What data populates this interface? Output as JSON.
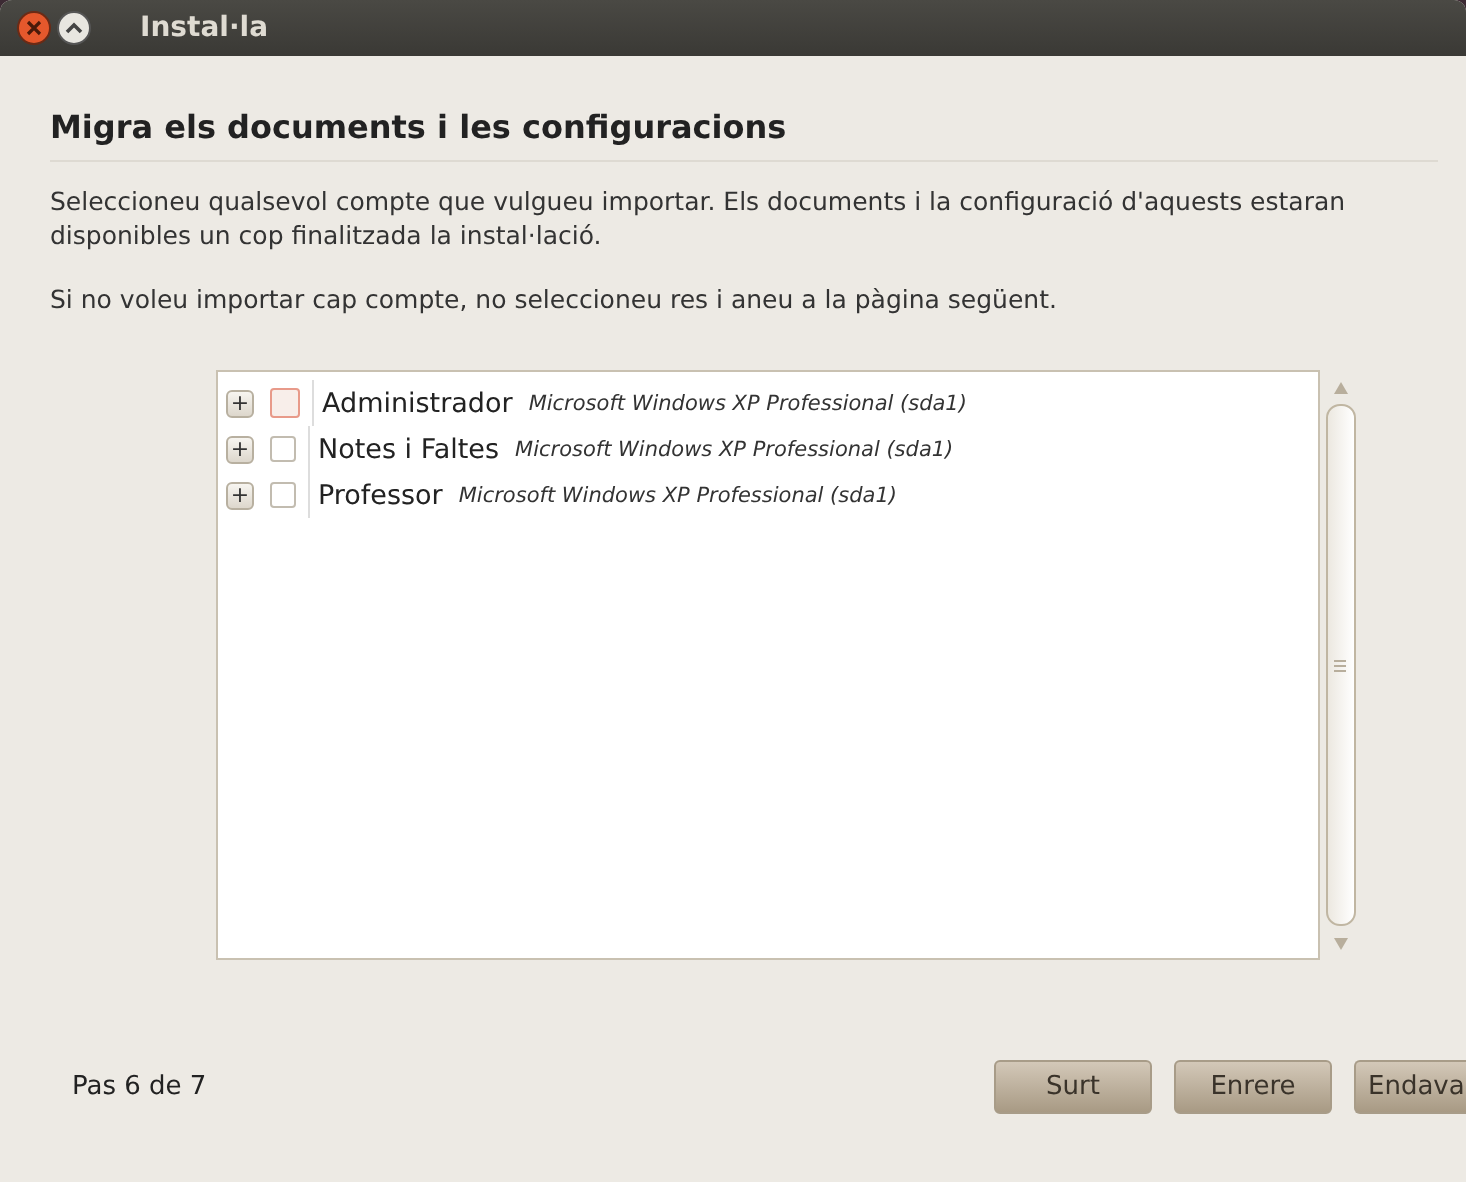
{
  "window": {
    "title": "Instal·la"
  },
  "heading": "Migra els documents i les configuracions",
  "paragraphs": [
    "Seleccioneu qualsevol compte que vulgueu importar. Els documents i la configuració d'aquests estaran disponibles un cop finalitzada la instal·lació.",
    "Si no voleu importar cap compte, no seleccioneu res i aneu a la pàgina següent."
  ],
  "accounts": [
    {
      "expander": "+",
      "name": "Administrador",
      "system": "Microsoft Windows XP Professional (sda1)",
      "checked": false,
      "focused": true
    },
    {
      "expander": "+",
      "name": "Notes i Faltes",
      "system": "Microsoft Windows XP Professional (sda1)",
      "checked": false,
      "focused": false
    },
    {
      "expander": "+",
      "name": "Professor",
      "system": "Microsoft Windows XP Professional (sda1)",
      "checked": false,
      "focused": false
    }
  ],
  "step": "Pas 6 de 7",
  "buttons": [
    "Surt",
    "Enrere",
    "Endava"
  ]
}
